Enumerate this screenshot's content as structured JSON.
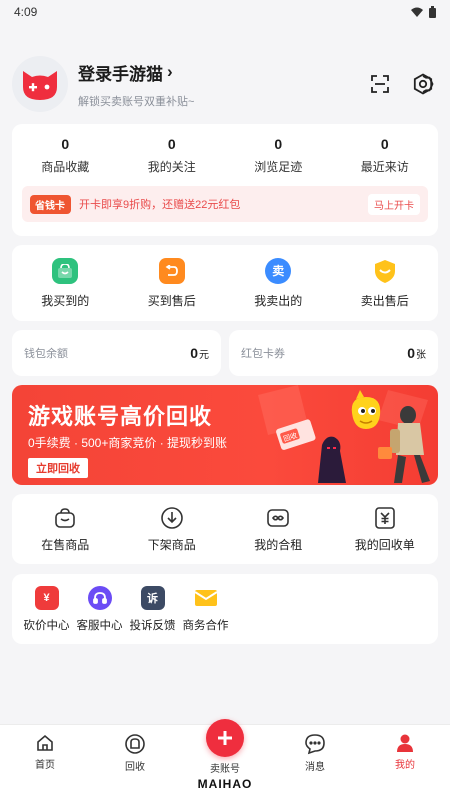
{
  "status": {
    "time": "4:09"
  },
  "profile": {
    "name": "登录手游猫",
    "subtitle": "解锁买卖账号双重补贴~",
    "chevron": "›"
  },
  "stats": [
    {
      "value": "0",
      "label": "商品收藏"
    },
    {
      "value": "0",
      "label": "我的关注"
    },
    {
      "value": "0",
      "label": "浏览足迹"
    },
    {
      "value": "0",
      "label": "最近来访"
    }
  ],
  "promo": {
    "badge": "省钱卡",
    "text": "开卡即享9折购，还赠送22元红包",
    "button": "马上开卡"
  },
  "orders": [
    {
      "label": "我买到的",
      "icon": "bag-icon",
      "color": "#2ec27e"
    },
    {
      "label": "买到售后",
      "icon": "return-icon",
      "color": "#ff8a1f"
    },
    {
      "label": "我卖出的",
      "icon": "sell-icon",
      "color": "#3b8cff",
      "glyph": "卖"
    },
    {
      "label": "卖出售后",
      "icon": "shield-icon",
      "color": "#ffc21a"
    }
  ],
  "wallet": {
    "balance_label": "钱包余额",
    "balance_value": "0",
    "balance_unit": "元",
    "coupon_label": "红包卡券",
    "coupon_value": "0",
    "coupon_unit": "张"
  },
  "banner": {
    "title": "游戏账号高价回收",
    "subtitle": "0手续费 · 500+商家竞价 · 提现秒到账",
    "button": "立即回收",
    "tag": "回收"
  },
  "tools": [
    {
      "label": "在售商品",
      "icon": "shop-bag-icon"
    },
    {
      "label": "下架商品",
      "icon": "download-circle-icon"
    },
    {
      "label": "我的合租",
      "icon": "share-icon"
    },
    {
      "label": "我的回收单",
      "icon": "yuan-receipt-icon"
    }
  ],
  "services": [
    {
      "label": "砍价中心",
      "icon": "bargain-icon",
      "color": "#ef3b3b",
      "glyph": "¥"
    },
    {
      "label": "客服中心",
      "icon": "headset-icon",
      "color": "#6b4cf5"
    },
    {
      "label": "投诉反馈",
      "icon": "complaint-icon",
      "color": "#3c4a64",
      "glyph": "诉"
    },
    {
      "label": "商务合作",
      "icon": "envelope-icon",
      "color": "#ffc21a"
    }
  ],
  "tabbar": {
    "tabs": [
      {
        "label": "首页",
        "icon": "home-icon"
      },
      {
        "label": "回收",
        "icon": "recycle-icon"
      },
      {
        "label": "卖账号",
        "icon": "plus-icon"
      },
      {
        "label": "消息",
        "icon": "message-icon"
      },
      {
        "label": "我的",
        "icon": "user-icon"
      }
    ],
    "brand": "MAIHAO"
  },
  "colors": {
    "accent": "#ef2e3e",
    "background": "#f5f5f7"
  }
}
